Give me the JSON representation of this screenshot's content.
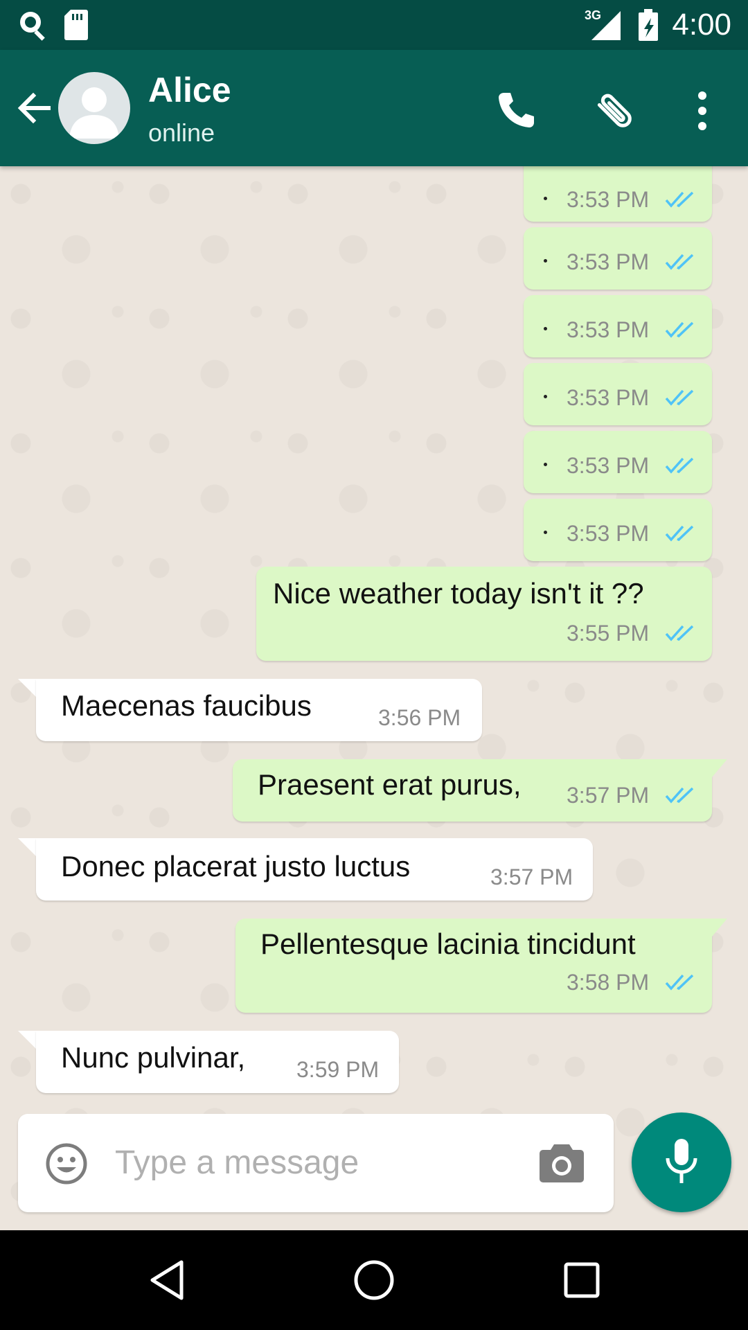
{
  "status_bar": {
    "time": "4:00",
    "network": "3G",
    "icons": [
      "search-notification-icon",
      "sd-card-icon",
      "signal-icon",
      "battery-icon"
    ]
  },
  "header": {
    "contact_name": "Alice",
    "contact_status": "online",
    "icons": [
      "back-arrow-icon",
      "avatar-placeholder-icon",
      "phone-icon",
      "attachment-icon",
      "more-vert-icon"
    ]
  },
  "messages": [
    {
      "direction": "out",
      "text": "",
      "time": "3:53 PM",
      "status": "read"
    },
    {
      "direction": "out",
      "text": "",
      "time": "3:53 PM",
      "status": "read"
    },
    {
      "direction": "out",
      "text": "",
      "time": "3:53 PM",
      "status": "read"
    },
    {
      "direction": "out",
      "text": "",
      "time": "3:53 PM",
      "status": "read"
    },
    {
      "direction": "out",
      "text": "",
      "time": "3:53 PM",
      "status": "read"
    },
    {
      "direction": "out",
      "text": "",
      "time": "3:53 PM",
      "status": "read"
    },
    {
      "direction": "out",
      "text": "Nice weather today isn't it ??",
      "time": "3:55 PM",
      "status": "read"
    },
    {
      "direction": "in",
      "text": "Maecenas faucibus",
      "time": "3:56 PM"
    },
    {
      "direction": "out",
      "text": "Praesent erat purus,",
      "time": "3:57 PM",
      "status": "read"
    },
    {
      "direction": "in",
      "text": "Donec placerat justo luctus",
      "time": "3:57 PM"
    },
    {
      "direction": "out",
      "text": "Pellentesque lacinia tincidunt",
      "time": "3:58 PM",
      "status": "read"
    },
    {
      "direction": "in",
      "text": "Nunc pulvinar,",
      "time": "3:59 PM"
    }
  ],
  "composer": {
    "placeholder": "Type a message",
    "value": "",
    "icons": [
      "emoji-icon",
      "camera-icon",
      "mic-icon"
    ]
  },
  "nav_bar": {
    "icons": [
      "nav-back-icon",
      "nav-home-icon",
      "nav-recents-icon"
    ]
  },
  "colors": {
    "status_bar": "#054c44",
    "app_bar": "#075e54",
    "chat_background": "#ece5dd",
    "outgoing_bubble": "#dcf8c6",
    "incoming_bubble": "#ffffff",
    "read_ticks": "#4fc3f7",
    "mic_button": "#00897b"
  }
}
